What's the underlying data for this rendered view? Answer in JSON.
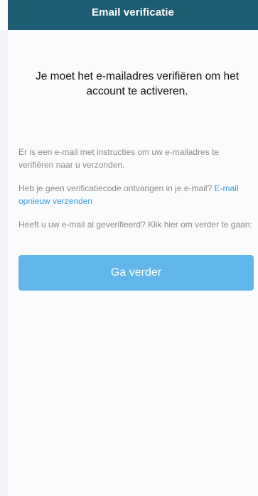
{
  "header": {
    "title": "Email verificatie"
  },
  "main": {
    "headline": "Je moet het e-mailadres verifiëren om het account te activeren.",
    "paragraph_sent": "Er is een e-mail met instructies om uw e-mailadres te verifiëren naar u verzonden.",
    "paragraph_resend_prefix": "Heb je geen verificatiecode ontvangen in je e-mail? ",
    "resend_link": "E-mail opnieuw verzenden",
    "paragraph_continue": "Heeft u uw e-mail al geverifieerd? Klik hier om verder te gaan:",
    "continue_button": "Ga verder"
  },
  "colors": {
    "header_bg": "#1e5c74",
    "link": "#3a9bd8",
    "button_bg": "#62b7ea"
  }
}
